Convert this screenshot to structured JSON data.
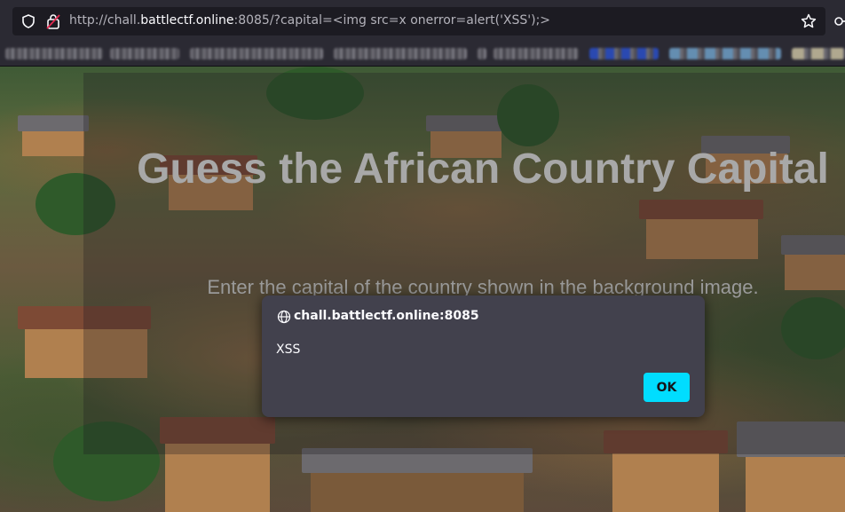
{
  "browser": {
    "url_prefix": "http://chall.",
    "url_host": "battlectf.online",
    "url_suffix": ":8085/?capital=<img src=x onerror=alert('XSS');>",
    "icons": [
      "shield-icon",
      "lock-icon",
      "star-icon",
      "extension-icon"
    ]
  },
  "page": {
    "title": "Guess the African Country Capital",
    "subtitle": "Enter the capital of the country shown in the background image."
  },
  "alert": {
    "origin": "chall.battlectf.online:8085",
    "message": "XSS",
    "ok_label": "OK",
    "icon": "globe-icon",
    "accent": "#00ddff"
  },
  "colors": {
    "toolbar": "#2b2a33",
    "urlbar": "#1c1b22",
    "dialog": "#42414d"
  }
}
